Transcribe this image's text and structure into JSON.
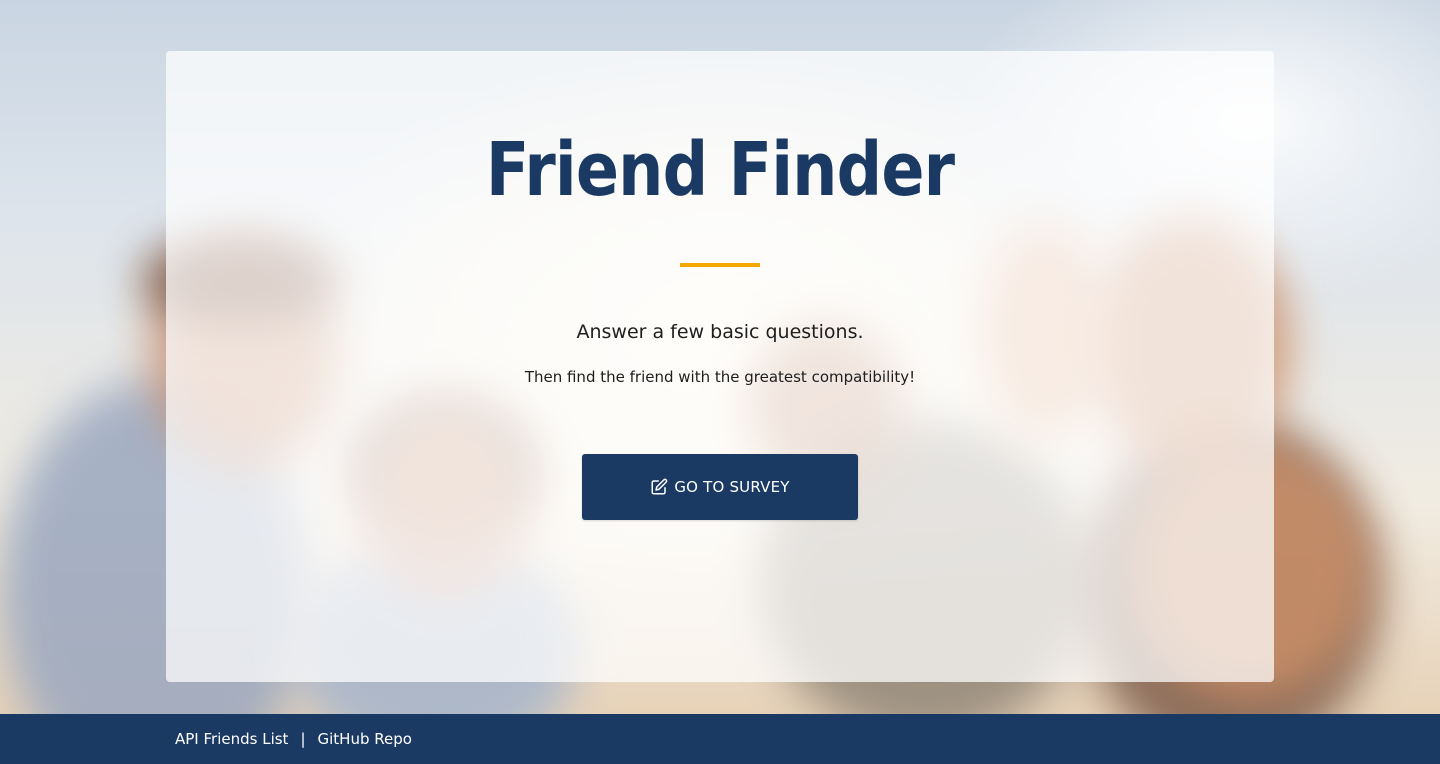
{
  "hero": {
    "title": "Friend Finder",
    "subtitle": "Answer a few basic questions.",
    "tagline": "Then find the friend with the greatest compatibility!",
    "button_label": "GO TO SURVEY",
    "button_icon": "edit-icon",
    "accent_color": "#f5a800",
    "brand_color": "#1b3a63"
  },
  "footer": {
    "links": [
      {
        "label": "API Friends List"
      },
      {
        "label": "GitHub Repo"
      }
    ],
    "separator": "|"
  }
}
